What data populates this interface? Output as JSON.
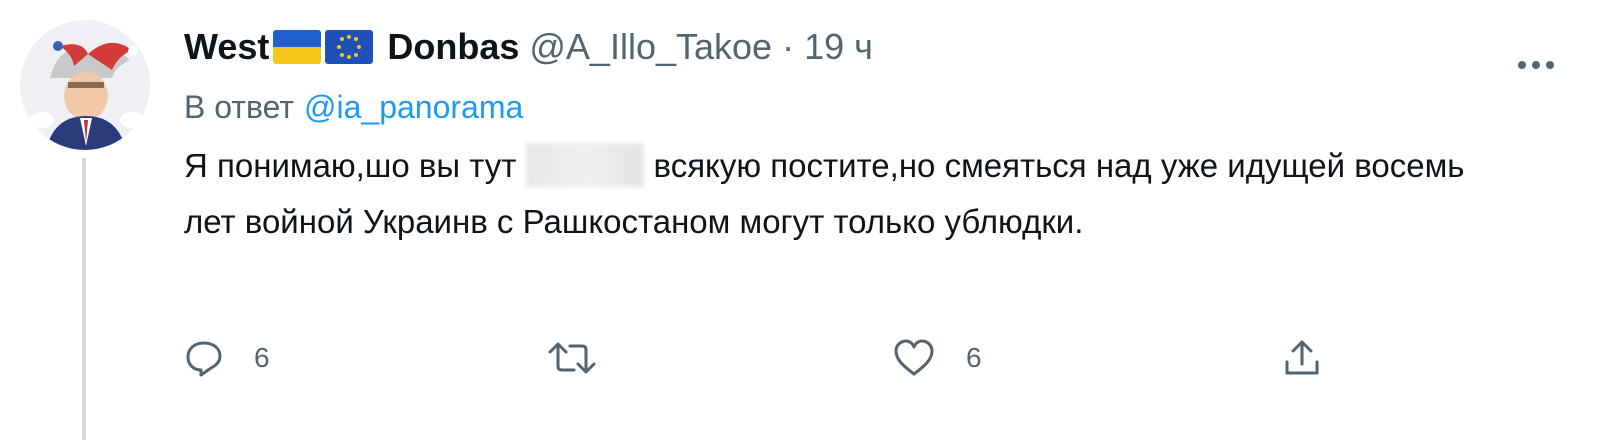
{
  "tweet": {
    "display_name": "West",
    "display_name_suffix": "Donbas",
    "handle": "@A_Illo_Takoe",
    "separator": "·",
    "timestamp": "19 ч",
    "reply_prefix": "В ответ",
    "reply_mention": "@ia_panorama",
    "text_part1": "Я понимаю,шо вы тут",
    "text_part2": "всякую постите,но смеяться над уже идущей восемь лет войной Украинв с Рашкостаном могут только ублюдки.",
    "flags": [
      "ukraine-flag-icon",
      "eu-flag-icon"
    ]
  },
  "actions": {
    "reply_count": "6",
    "retweet_count": "",
    "like_count": "6"
  },
  "colors": {
    "accent": "#1d9bf0",
    "secondary_text": "#536471",
    "primary_text": "#0f1419",
    "thread_line": "#cfd9de"
  }
}
